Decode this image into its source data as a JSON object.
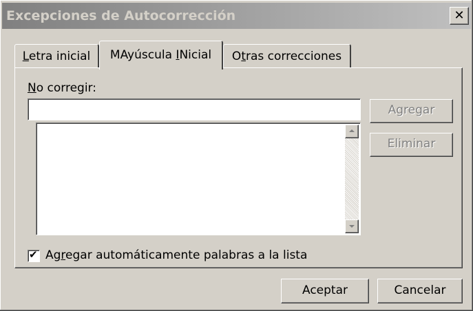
{
  "dialog": {
    "title": "Excepciones de Autocorrección",
    "close_glyph": "✕"
  },
  "tabs": [
    {
      "pre": "",
      "key": "L",
      "post": "etra inicial",
      "active": false
    },
    {
      "pre": "MAyúscula ",
      "key": "I",
      "post": "Nicial",
      "active": true
    },
    {
      "pre": "O",
      "key": "t",
      "post": "ras correcciones",
      "active": false
    }
  ],
  "panel": {
    "no_corregir_key": "N",
    "no_corregir_rest": "o corregir:",
    "input_value": "",
    "list_items": [],
    "agregar_label": "Agregar",
    "eliminar_label": "Eliminar",
    "checkbox": {
      "checked": true,
      "pre": "Ag",
      "key": "r",
      "post": "egar automáticamente palabras a la lista"
    }
  },
  "footer": {
    "ok_label": "Aceptar",
    "cancel_label": "Cancelar"
  },
  "icons": {
    "check": "✔"
  }
}
